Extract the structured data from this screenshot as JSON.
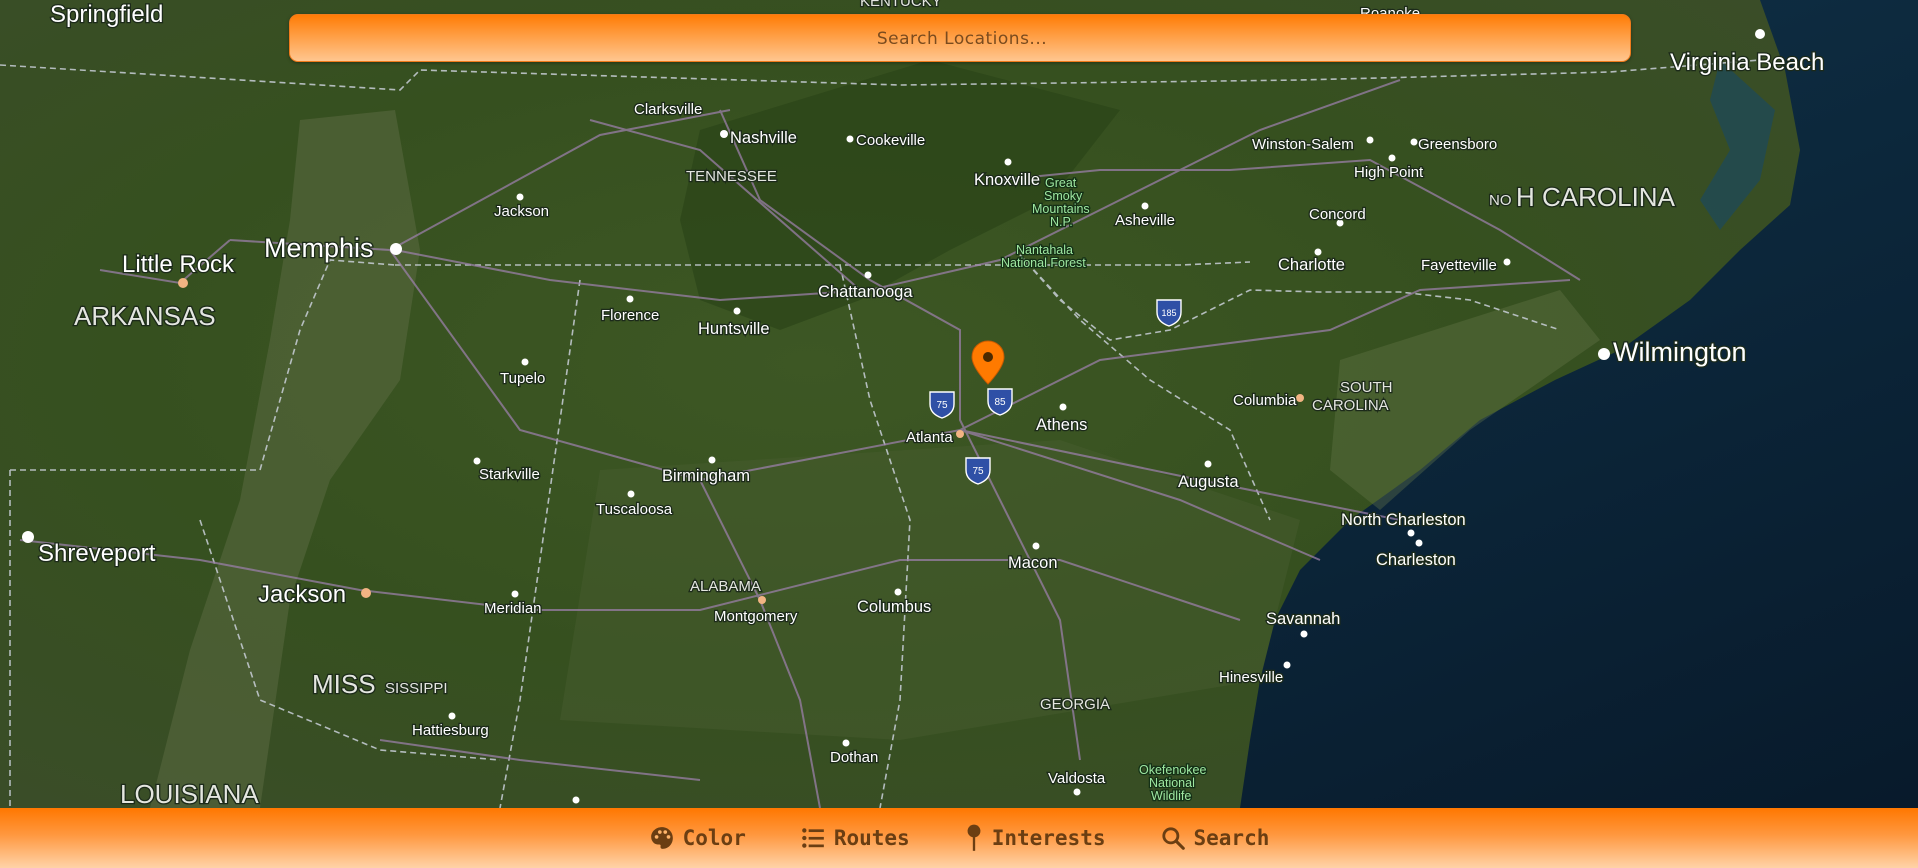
{
  "search": {
    "placeholder": "Search Locations..."
  },
  "nav": [
    {
      "icon": "palette-icon",
      "label": "Color"
    },
    {
      "icon": "list-icon",
      "label": "Routes"
    },
    {
      "icon": "pin-icon",
      "label": "Interests"
    },
    {
      "icon": "search-icon",
      "label": "Search"
    }
  ],
  "map": {
    "marker": {
      "icon": "location-marker-icon",
      "color": "#ff7a00"
    },
    "states": [
      "TENNESSEE",
      "ARKANSAS",
      "ALABAMA",
      "GEORGIA",
      "MISSISSIPPI",
      "LOUISIANA",
      "SOUTH CAROLINA",
      "NORTH CAROLINA",
      "KENTUCKY"
    ],
    "state_labels": {
      "tennessee": "TENNESSEE",
      "arkansas": "ARKANSAS",
      "alabama": "ALABAMA",
      "georgia": "GEORGIA",
      "mississippi_a": "MISS",
      "mississippi_b": "SISSIPPI",
      "louisiana": "LOUISIANA",
      "south_carolina_a": "SOUTH",
      "south_carolina_b": "CAROLINA",
      "north_carolina_a": "NO",
      "north_carolina_b": "H CAROLINA",
      "kentucky": "KENTUCKY"
    },
    "cities": {
      "springfield": "Springfield",
      "roanoke": "Roanoke",
      "virginia_beach": "Virginia Beach",
      "clarksville": "Clarksville",
      "nashville": "Nashville",
      "cookeville": "Cookeville",
      "knoxville": "Knoxville",
      "winston_salem": "Winston-Salem",
      "greensboro": "Greensboro",
      "high_point": "High Point",
      "jackson_tn": "Jackson",
      "asheville": "Asheville",
      "concord": "Concord",
      "memphis": "Memphis",
      "little_rock": "Little Rock",
      "charlotte": "Charlotte",
      "fayetteville": "Fayetteville",
      "chattanooga": "Chattanooga",
      "florence": "Florence",
      "huntsville": "Huntsville",
      "wilmington": "Wilmington",
      "tupelo": "Tupelo",
      "columbia": "Columbia",
      "athens": "Athens",
      "atlanta": "Atlanta",
      "starkville": "Starkville",
      "birmingham": "Birmingham",
      "augusta": "Augusta",
      "tuscaloosa": "Tuscaloosa",
      "shreveport": "Shreveport",
      "north_charleston": "North Charleston",
      "charleston": "Charleston",
      "jackson_ms": "Jackson",
      "macon": "Macon",
      "meridian": "Meridian",
      "montgomery": "Montgomery",
      "columbus": "Columbus",
      "savannah": "Savannah",
      "hinesville": "Hinesville",
      "hattiesburg": "Hattiesburg",
      "dothan": "Dothan",
      "valdosta": "Valdosta"
    },
    "parks": {
      "smoky_1": "Great",
      "smoky_2": "Smoky",
      "smoky_3": "Mountains",
      "smoky_4": "N.P.",
      "nantahala_1": "Nantahala",
      "nantahala_2": "National Forest",
      "okefenokee_1": "Okefenokee",
      "okefenokee_2": "National",
      "okefenokee_3": "Wildlife"
    },
    "interstates": {
      "i75": "75",
      "i85": "85",
      "i185": "185"
    }
  },
  "colors": {
    "accent": "#ff7a00",
    "bar_text": "#6b3e12",
    "ocean": "#0b2438",
    "land": "#3c5226"
  }
}
